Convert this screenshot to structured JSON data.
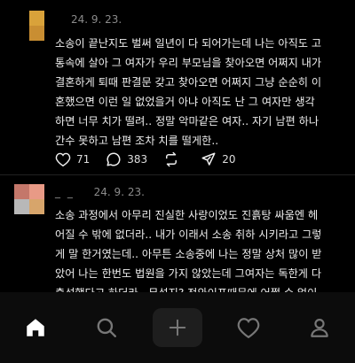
{
  "posts": [
    {
      "date": "24. 9. 23.",
      "dots": "",
      "text": "소송이 끝난지도 벌써 일년이 다 되어가는데 나는 아직도 고\n통속에 살아 그 여자가 우리 부모님을 찾아오면 어쩌지 내가\n결혼하게 퇴때 판결문 갖고 찾아오면 어쩌지 그냥 순순히 이\n혼했으면 이런 일 없었을거 아냐 아직도 난 그 여자만 생각\n하면 너무 치가 떨려.. 정말 악마같은 여자.. 자기 남편 하나\n간수 못하고 남편 조차 치를 떨게한..",
      "likes": "71",
      "comments": "383",
      "shares": "20"
    },
    {
      "date": "24. 9. 23.",
      "dots": "_ _",
      "text": "소송 과정에서 아무리 진실한 사랑이었도 진흙탕 싸움엔 헤\n어질 수 밖에 없더라.. 내가 이래서 소송 취하 시키라고 그렇\n게 말 한거였는데.. 아무튼 소송중에 나는 정말 상처 많이 받\n았어 나는 한번도 법원을 가지 않았는데 그여자는 독한게 다\n출석했다고 하더라.. 무섭지? 전와이프때문에 어쩔 수 없이"
    }
  ],
  "icons": {
    "like": "heart-icon",
    "comment": "comment-bubble-icon",
    "repost": "repost-icon",
    "share": "send-icon",
    "home": "home-icon",
    "search": "search-icon",
    "compose": "plus-icon",
    "activity": "heart-outline-icon",
    "profile": "profile-icon"
  },
  "colors": {
    "background": "#000000",
    "text": "#eeeeee",
    "muted": "#888888",
    "nav_bg": "#0c0c0c"
  }
}
